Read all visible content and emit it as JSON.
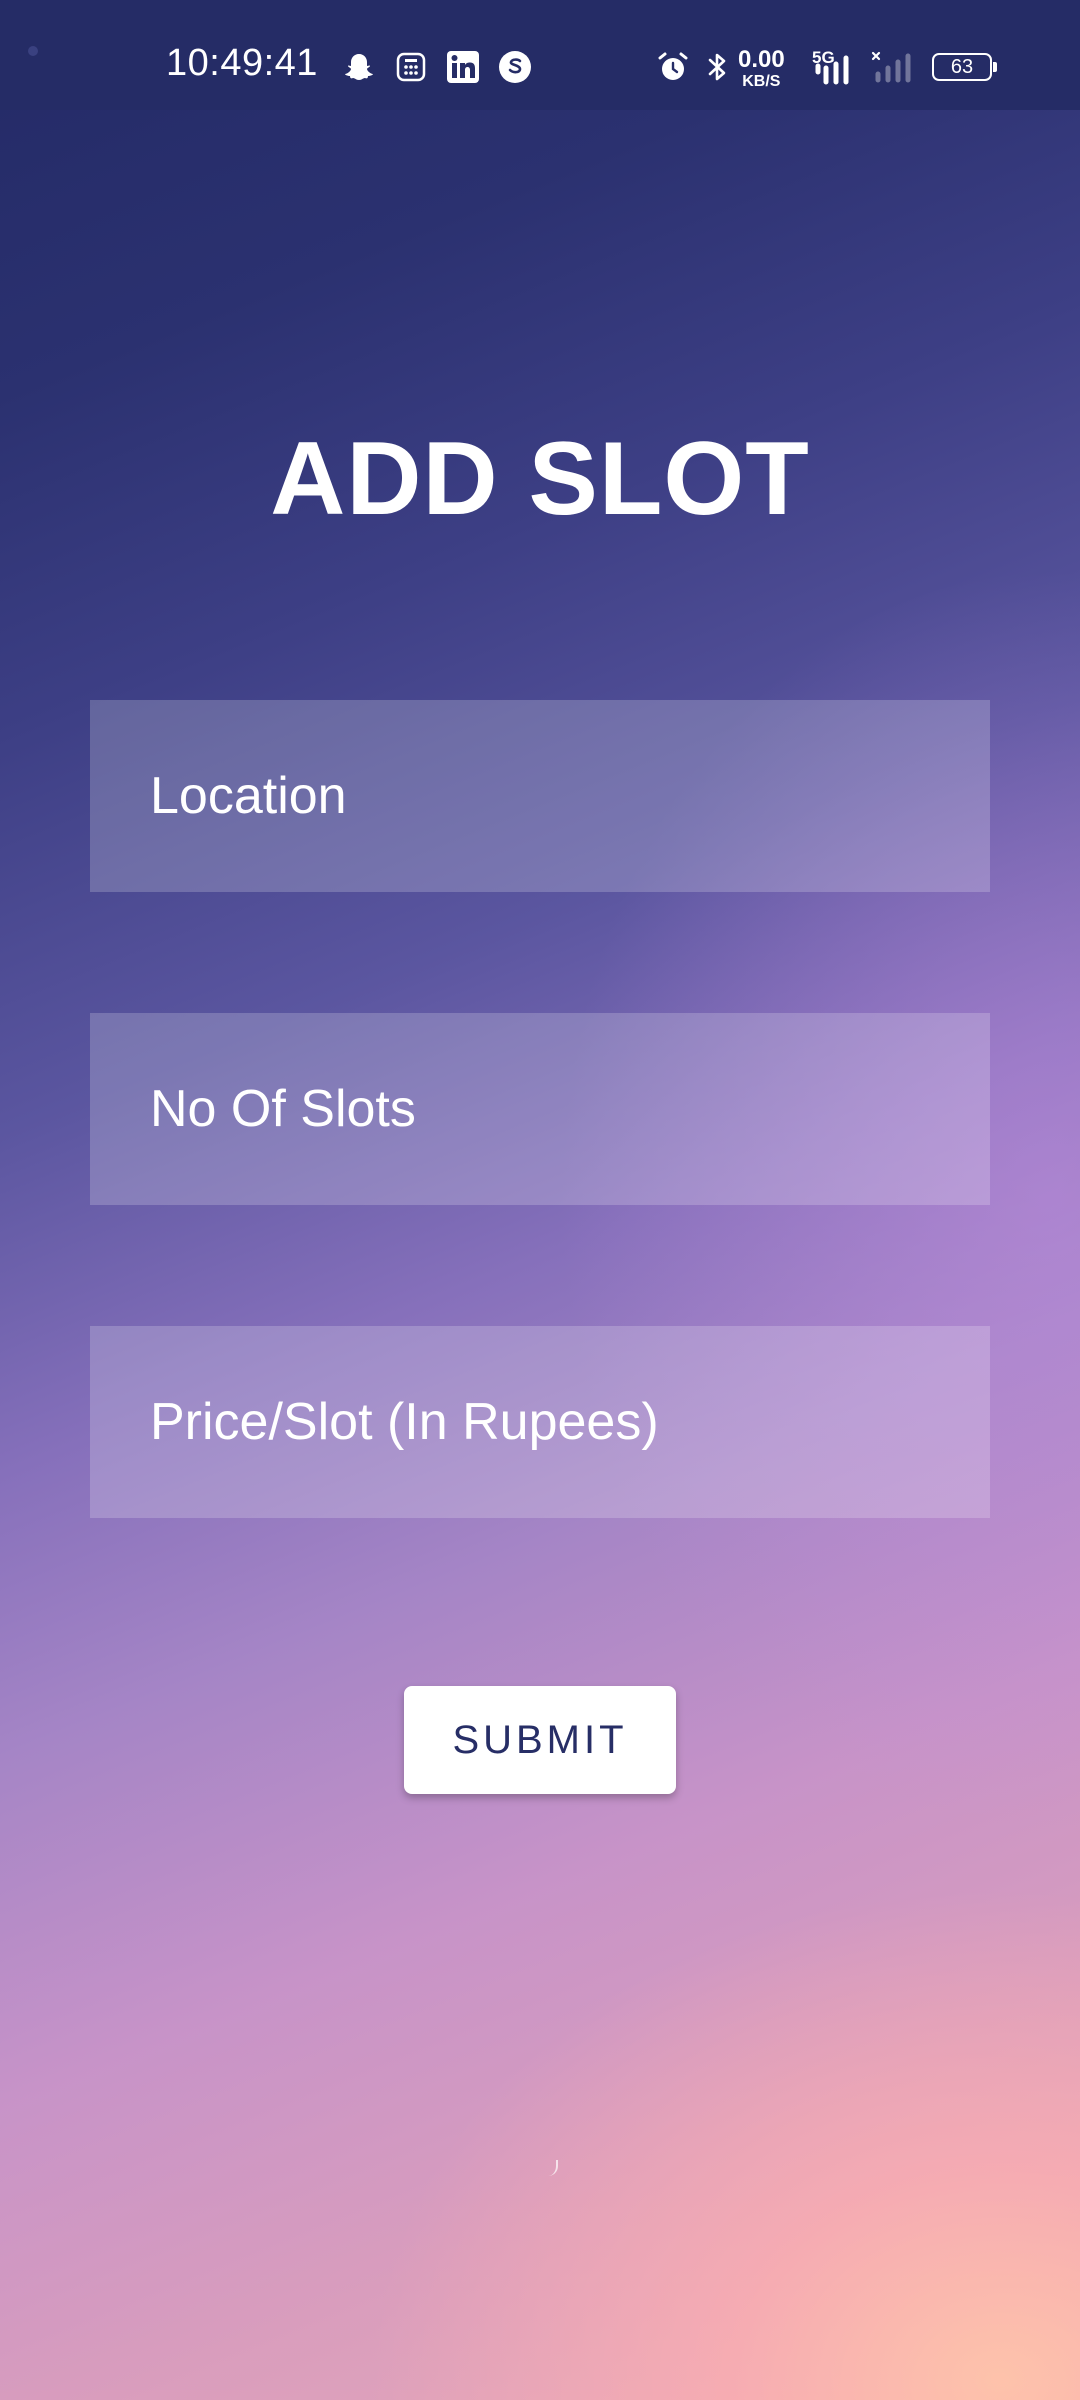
{
  "status_bar": {
    "time": "10:49:41",
    "notification_icons": [
      "snapchat-icon",
      "calculator-icon",
      "linkedin-icon",
      "s-app-icon"
    ],
    "system_icons": [
      "alarm-icon",
      "bluetooth-icon",
      "signal-5g-icon",
      "signal-no-service-icon"
    ],
    "net_speed_value": "0.00",
    "net_speed_unit": "KB/S",
    "network_type": "5G",
    "battery_level": "63"
  },
  "page": {
    "title": "ADD SLOT"
  },
  "form": {
    "location_placeholder": "Location",
    "slots_placeholder": "No Of Slots",
    "price_placeholder": "Price/Slot (In Rupees)",
    "submit_label": "SUBMIT"
  },
  "colors": {
    "status_bar_bg": "#252c66",
    "background_top": "#232a66",
    "background_mid": "#8670bb",
    "background_bottom": "#f0a6b0",
    "button_text": "#272e66",
    "button_bg": "#ffffff"
  }
}
